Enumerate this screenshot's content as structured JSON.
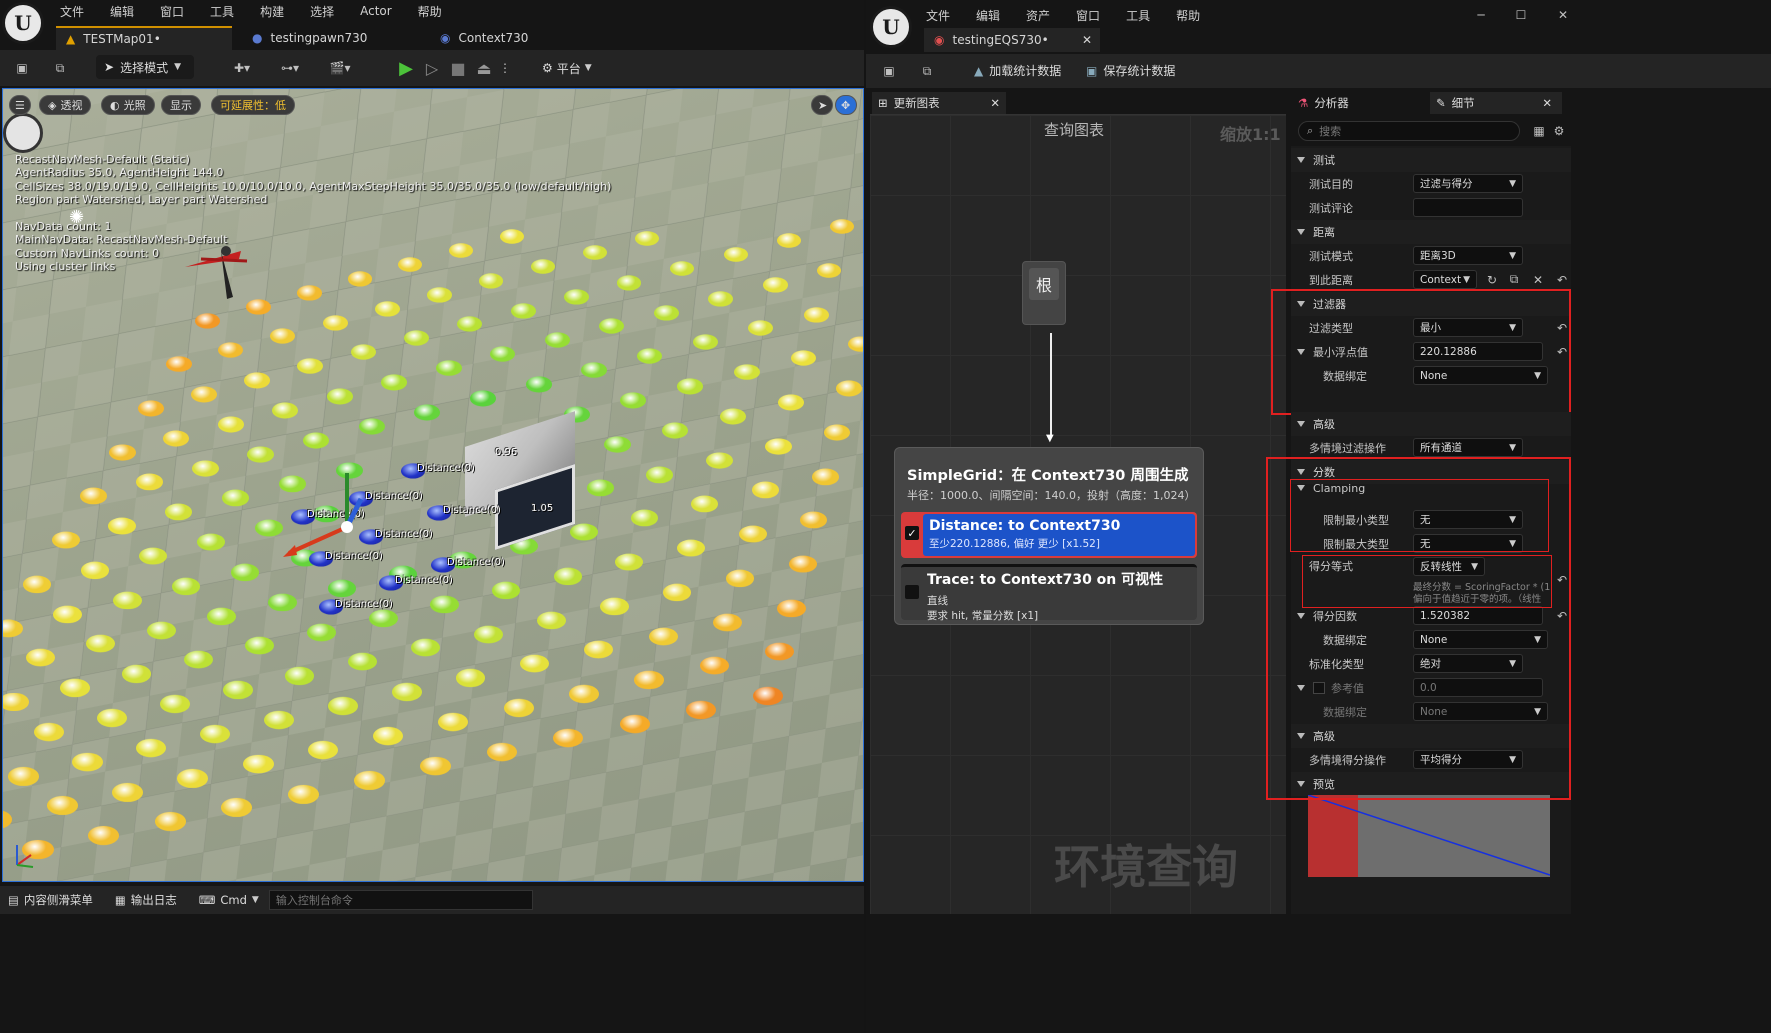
{
  "left_window": {
    "menu": [
      "文件",
      "编辑",
      "窗口",
      "工具",
      "构建",
      "选择",
      "Actor",
      "帮助"
    ],
    "tabs": [
      "TESTMap01•",
      "testingpawn730",
      "Context730"
    ],
    "toolbar": {
      "mode": "选择模式",
      "platform": "平台"
    },
    "viewport": {
      "buttons": [
        "透视",
        "光照",
        "显示"
      ],
      "scalability": "可延展性：低",
      "overlay_lines_1": "RecastNavMesh-Default (Static)\nAgentRadius 35.0, AgentHeight 144.0\nCellSizes 38.0/19.0/19.0, CellHeights 10.0/10.0/10.0, AgentMaxStepHeight 35.0/35.0/35.0 (low/default/high)\nRegion part Watershed, Layer part Watershed",
      "overlay_lines_2": "NavData count: 1\nMainNavData: RecastNavMesh-Default\nCustom NavLinks count: 0\nUsing cluster links",
      "distance_label": "Distance(0)",
      "cube_labels": [
        "0.96",
        "1.05"
      ]
    },
    "statusbar": {
      "content_drawer": "内容侧滑菜单",
      "output_log": "输出日志",
      "cmd": "Cmd",
      "console_placeholder": "输入控制台命令"
    }
  },
  "right_window": {
    "menu": [
      "文件",
      "编辑",
      "资产",
      "窗口",
      "工具",
      "帮助"
    ],
    "tab": "testingEQS730•",
    "toolbar": {
      "load_stats": "加载统计数据",
      "save_stats": "保存统计数据"
    },
    "graph_tab": "更新图表",
    "graph_title": "查询图表",
    "zoom": "缩放1:1",
    "root_node": "根",
    "generator": {
      "title": "SimpleGrid：在 Context730 周围生成",
      "subtitle": "半径：1000.0、间隔空间：140.0，投射（高度：1,024）"
    },
    "tests": [
      {
        "title": "Distance: to Context730",
        "detail": "至少220.12886, 偏好 更少 [x1.52]",
        "checked": true
      },
      {
        "title": "Trace: to Context730 on 可视性",
        "detail": "直线",
        "detail2": "要求 hit, 常量分数 [x1]",
        "checked": false
      }
    ],
    "watermark": "环境查询",
    "panels": {
      "profiler": "分析器",
      "details": "细节",
      "search_placeholder": "搜索"
    },
    "details": {
      "sec_test": "测试",
      "test_purpose_label": "测试目的",
      "test_purpose": "过滤与得分",
      "test_comment_label": "测试评论",
      "sec_distance": "距离",
      "test_mode_label": "测试模式",
      "test_mode": "距离3D",
      "distance_to_label": "到此距离",
      "distance_to": "Context",
      "sec_filter": "过滤器",
      "filter_type_label": "过滤类型",
      "filter_type": "最小",
      "float_min_label": "最小浮点值",
      "float_min": "220.12886",
      "data_binding_label": "数据绑定",
      "data_binding": "None",
      "sec_advanced": "高级",
      "multi_filter_label": "多情境过滤操作",
      "multi_filter": "所有通道",
      "sec_score": "分数",
      "clamping": "Clamping",
      "clamp_min_label": "限制最小类型",
      "clamp_min": "无",
      "clamp_max_label": "限制最大类型",
      "clamp_max": "无",
      "score_eq_label": "得分等式",
      "score_eq": "反转线性",
      "score_eq_hint1": "最终分数 = ScoringFactor * (1",
      "score_eq_hint2": "偏向于值趋近于零的项。（线性",
      "score_factor_label": "得分因数",
      "score_factor": "1.520382",
      "score_binding_label": "数据绑定",
      "score_binding": "None",
      "normalize_label": "标准化类型",
      "normalize": "绝对",
      "ref_label": "参考值",
      "ref_value": "0.0",
      "ref_binding_label": "数据绑定",
      "ref_binding": "None",
      "sec_advanced2": "高级",
      "multi_score_label": "多情境得分操作",
      "multi_score": "平均得分",
      "sec_preview": "预览"
    }
  }
}
